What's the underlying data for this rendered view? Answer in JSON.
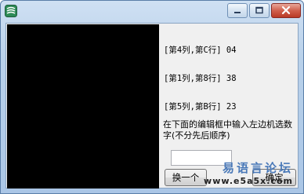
{
  "window": {
    "icon": "app-icon",
    "controls": {
      "minimize_icon": "minimize-icon",
      "maximize_icon": "maximize-icon",
      "close_icon": "close-icon",
      "close_color": "#c94a36"
    }
  },
  "canvas": {
    "background": "#000000"
  },
  "rows": [
    "[第4列,第C行] 04",
    "[第1列,第8行] 38",
    "[第5列,第B行] 23"
  ],
  "instruction": "在下面的编辑框中输入左边机选数字(不分先后顺序)",
  "input": {
    "value": ""
  },
  "buttons": {
    "swap_label": "换一个",
    "ok_label": "确定"
  },
  "watermark": {
    "chinese": "易语言论坛",
    "url": "www.e5a5x.com"
  }
}
